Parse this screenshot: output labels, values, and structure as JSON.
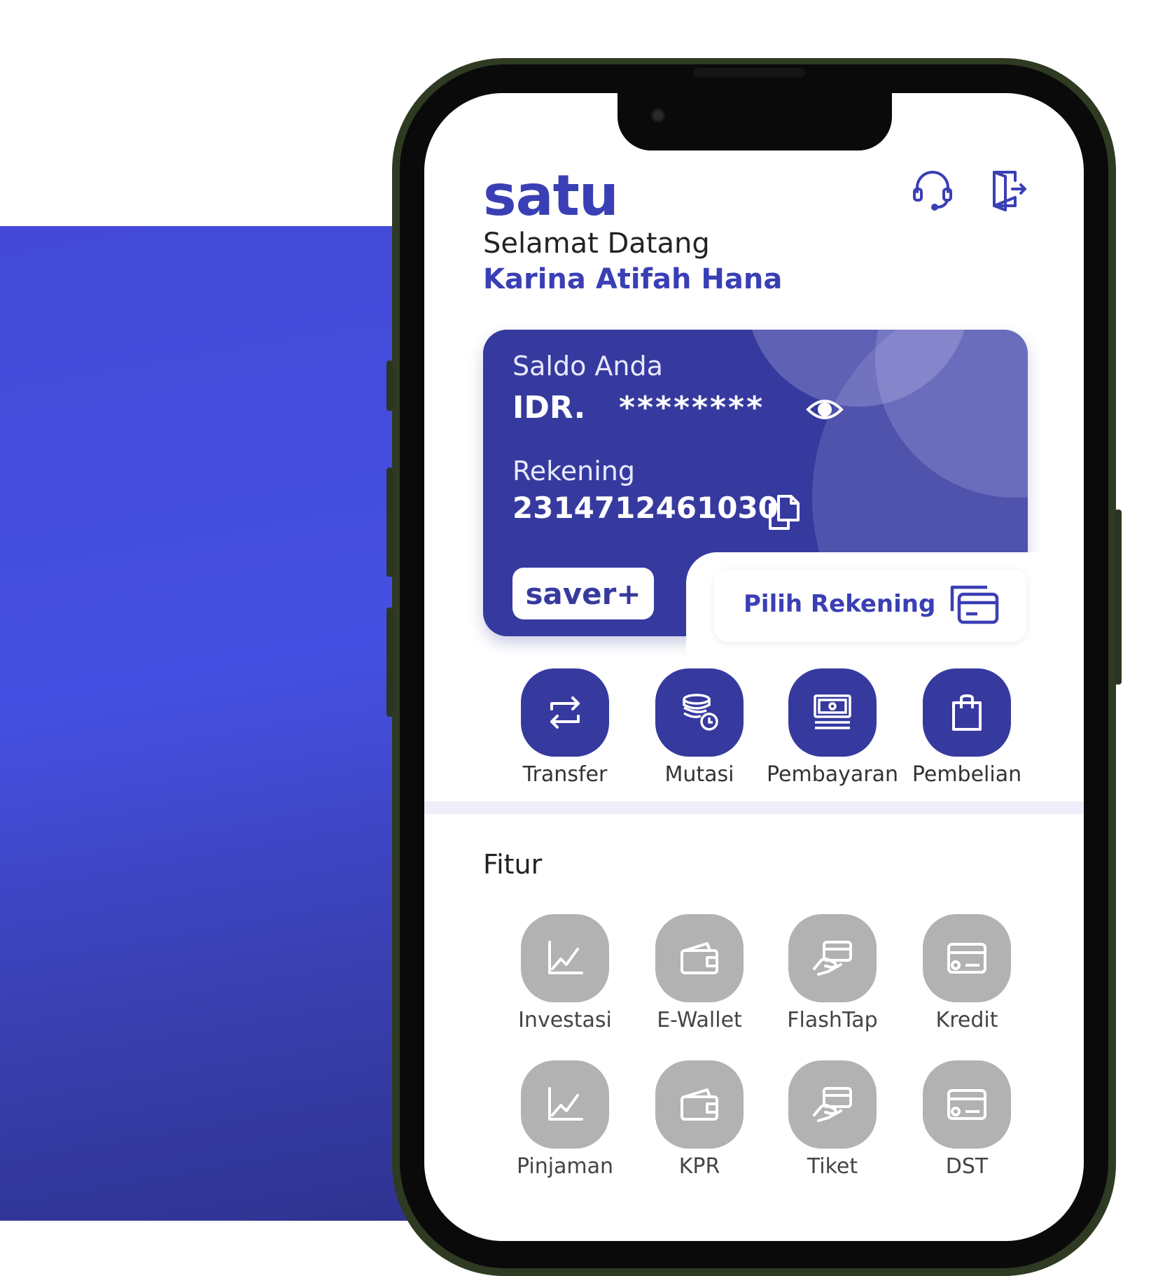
{
  "app": {
    "logo": "satu"
  },
  "header": {
    "welcome": "Selamat Datang",
    "user_name": "Karina Atifah Hana",
    "support_icon": "headset-icon",
    "logout_icon": "logout-door-icon"
  },
  "balance_card": {
    "balance_label": "Saldo Anda",
    "currency": "IDR.",
    "balance_masked": "********",
    "account_label": "Rekening",
    "account_number": "2314712461030",
    "product_badge": "saver+",
    "select_account": "Pilih Rekening"
  },
  "quick_actions": [
    {
      "label": "Transfer",
      "icon": "transfer-arrows-icon"
    },
    {
      "label": "Mutasi",
      "icon": "coins-clock-icon"
    },
    {
      "label": "Pembayaran",
      "icon": "bill-payment-icon"
    },
    {
      "label": "Pembelian",
      "icon": "shopping-bag-icon"
    }
  ],
  "features": {
    "title": "Fitur",
    "items": [
      {
        "label": "Investasi",
        "icon": "chart-line-icon"
      },
      {
        "label": "E-Wallet",
        "icon": "wallet-icon"
      },
      {
        "label": "FlashTap",
        "icon": "tap-card-icon"
      },
      {
        "label": "Kredit",
        "icon": "credit-card-icon"
      },
      {
        "label": "Pinjaman",
        "icon": "chart-line-icon"
      },
      {
        "label": "KPR",
        "icon": "wallet-icon"
      },
      {
        "label": "Tiket",
        "icon": "tap-card-icon"
      },
      {
        "label": "DST",
        "icon": "credit-card-icon"
      }
    ]
  },
  "colors": {
    "brand": "#3a3fb5",
    "card": "#363a9e",
    "feature_disabled": "#b2b2b2",
    "background_panel": "#4550e2",
    "phone_frame": "#2e3a22"
  }
}
